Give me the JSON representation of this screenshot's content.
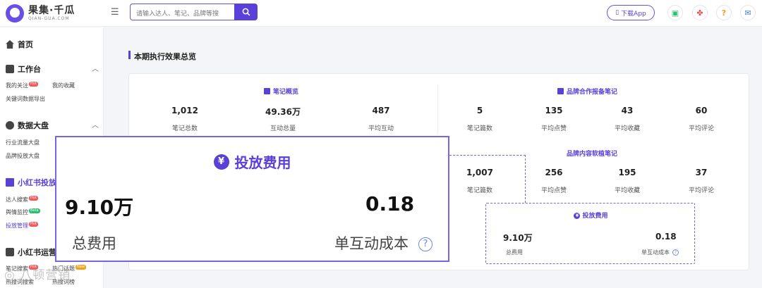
{
  "header": {
    "logo_name": "果集·千瓜",
    "logo_sub": "QIAN-GUA.COM",
    "search_placeholder": "请输入达人、笔记、品牌等搜",
    "download_label": "下载App"
  },
  "sidebar": {
    "home": "首页",
    "workbench": {
      "label": "工作台",
      "items": [
        "我的关注",
        "我的收藏",
        "关键词数据导出"
      ],
      "tag": "Hot"
    },
    "dashboard": {
      "label": "数据大盘",
      "items": [
        "行业流量大盘",
        "品牌投放大盘"
      ]
    },
    "xhs_ads": {
      "label": "小红书投放",
      "items": [
        "达人搜索",
        "舆情监控",
        "投放管理"
      ],
      "tags": [
        "Hot",
        "Beta",
        "Hot"
      ]
    },
    "xhs_ops": {
      "label": "小红书运营",
      "items": [
        "笔记搜索",
        "热搜词搜索",
        "热门话题",
        "热搜词榜"
      ],
      "tags": [
        "Hot",
        "New"
      ]
    }
  },
  "main": {
    "section_title": "本期执行效果总览",
    "notes_overview": {
      "title": "笔记概览",
      "stats": [
        {
          "value": "1,012",
          "label": "笔记总数"
        },
        {
          "value": "49.36万",
          "label": "互动总量"
        },
        {
          "value": "487",
          "label": "平均互动"
        }
      ]
    },
    "brand_coop": {
      "title": "品牌合作报备笔记",
      "stats": [
        {
          "value": "5",
          "label": "笔记篇数"
        },
        {
          "value": "135",
          "label": "平均点赞"
        },
        {
          "value": "43",
          "label": "平均收藏"
        },
        {
          "value": "60",
          "label": "平均评论"
        }
      ]
    },
    "brand_soft": {
      "title": "品牌内容软植笔记",
      "stats": [
        {
          "value": "1,007",
          "label": "笔记篇数"
        },
        {
          "value": "256",
          "label": "平均点赞"
        },
        {
          "value": "195",
          "label": "平均收藏"
        },
        {
          "value": "37",
          "label": "平均评论"
        }
      ]
    },
    "spend": {
      "title": "投放费用",
      "total_value": "9.10万",
      "total_label": "总费用",
      "cpe_value": "0.18",
      "cpe_label": "单互动成本"
    }
  },
  "zoom_panel": {
    "title": "投放费用",
    "total_value": "9.10万",
    "total_label": "总费用",
    "cpe_value": "0.18",
    "cpe_label": "单互动成本"
  },
  "watermark": "◎ 八顿营销",
  "colors": {
    "accent": "#5b3fd9",
    "dash": "#7a64e6"
  }
}
